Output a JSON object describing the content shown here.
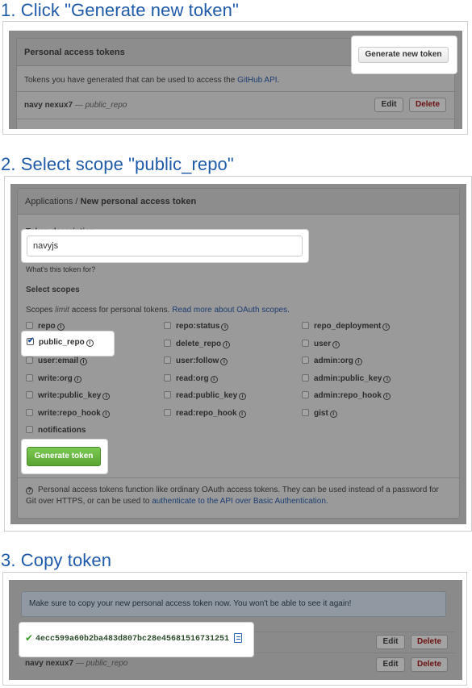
{
  "steps": {
    "one": "1. Click \"Generate new token\"",
    "two": "2. Select scope \"public_repo\"",
    "three": "3. Copy token"
  },
  "panel1": {
    "title": "Personal access tokens",
    "generate_button": "Generate new token",
    "description_prefix": "Tokens you have generated that can be used to access the ",
    "description_link": "GitHub API",
    "description_suffix": ".",
    "token_name": "navy nexux7",
    "token_sep": " — ",
    "token_scope": "public_repo",
    "edit_button": "Edit",
    "delete_button": "Delete"
  },
  "panel2": {
    "breadcrumb_root": "Applications",
    "breadcrumb_sep": " / ",
    "breadcrumb_current": "New personal access token",
    "token_description_label": "Token description",
    "token_description_value": "navyjs",
    "token_description_help": "What's this token for?",
    "select_scopes_label": "Select scopes",
    "scopes_help_prefix": "Scopes ",
    "scopes_help_em": "limit",
    "scopes_help_mid": " access for personal tokens. ",
    "scopes_help_link": "Read more about OAuth scopes.",
    "scopes": [
      {
        "name": "repo",
        "checked": false
      },
      {
        "name": "repo:status",
        "checked": false
      },
      {
        "name": "repo_deployment",
        "checked": false
      },
      {
        "name": "public_repo",
        "checked": true
      },
      {
        "name": "delete_repo",
        "checked": false
      },
      {
        "name": "user",
        "checked": false
      },
      {
        "name": "user:email",
        "checked": false
      },
      {
        "name": "user:follow",
        "checked": false
      },
      {
        "name": "admin:org",
        "checked": false
      },
      {
        "name": "write:org",
        "checked": false
      },
      {
        "name": "read:org",
        "checked": false
      },
      {
        "name": "admin:public_key",
        "checked": false
      },
      {
        "name": "write:public_key",
        "checked": false
      },
      {
        "name": "read:public_key",
        "checked": false
      },
      {
        "name": "admin:repo_hook",
        "checked": false
      },
      {
        "name": "write:repo_hook",
        "checked": false
      },
      {
        "name": "read:repo_hook",
        "checked": false
      },
      {
        "name": "gist",
        "checked": false
      },
      {
        "name": "notifications",
        "checked": false
      }
    ],
    "generate_token_button": "Generate token",
    "footer_line1": "Personal access tokens function like ordinary OAuth access tokens. They can be used instead of a password for",
    "footer_line2_prefix": "Git over HTTPS, or can be used to ",
    "footer_line2_link": "authenticate to the API over Basic Authentication."
  },
  "panel3": {
    "notice": "Make sure to copy your new personal access token now. You won't be able to see it again!",
    "token_value": "4ecc599a60b2ba483d807bc28e45681516731251",
    "edit_button": "Edit",
    "delete_button": "Delete",
    "token_name": "navy nexux7",
    "token_sep": " — ",
    "token_scope": "public_repo"
  },
  "colors": {
    "heading": "#1f5aa8",
    "green_button": "#5aa532",
    "link": "#1d3d70"
  }
}
